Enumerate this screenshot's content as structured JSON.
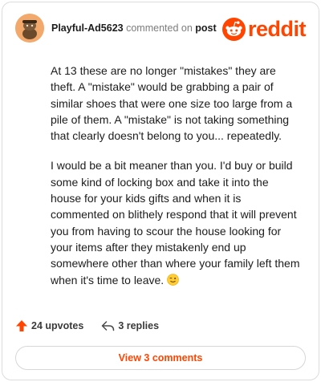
{
  "header": {
    "username": "Playful-Ad5623",
    "commented_on": "commented on",
    "post_label": "post",
    "brand": "reddit",
    "avatar_icon": "snoo-avatar-icon",
    "logo_icon": "reddit-alien-icon"
  },
  "comment": {
    "paragraphs": [
      "At 13 these are no longer \"mistakes\" they are theft. A \"mistake\" would be grabbing a pair of similar shoes that were one size too large from a pile of them. A \"mistake\" is not taking something that clearly doesn't belong to you... repeatedly.",
      "I would be a bit meaner than you. I'd buy or build some kind of locking box and take it into the house for your kids gifts and when it is commented on blithely respond that it will prevent you from having to scour the house looking for your items after they mistakenly end up somewhere other than where your family left them when it's time to leave."
    ],
    "emoji": "winking-face-emoji"
  },
  "footer": {
    "upvotes": "24 upvotes",
    "replies": "3 replies",
    "view_comments": "View 3 comments"
  },
  "colors": {
    "accent": "#ff4500",
    "text": "#1c1c1c",
    "muted": "#7c7c7c"
  }
}
